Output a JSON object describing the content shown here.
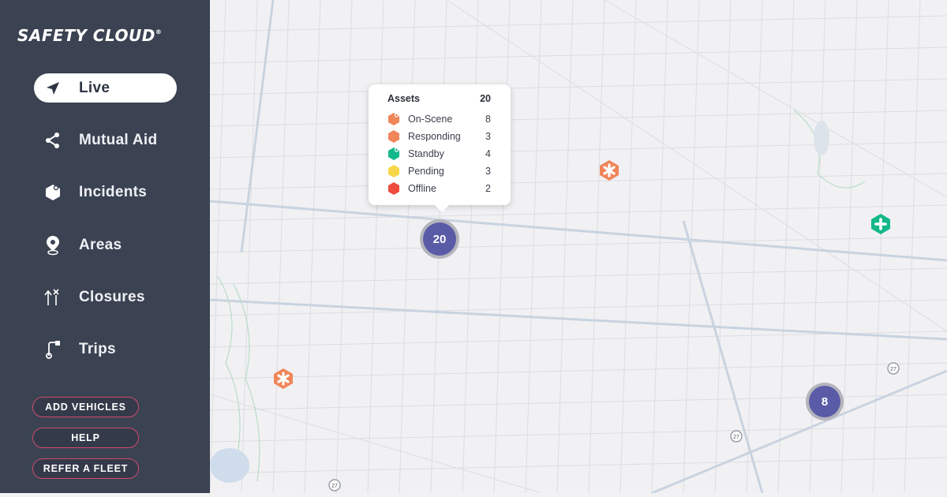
{
  "brand": {
    "name": "SAFETY CLOUD",
    "mark": "®"
  },
  "nav": [
    {
      "label": "Live",
      "icon": "navigation-arrow-icon",
      "active": true
    },
    {
      "label": "Mutual Aid",
      "icon": "share-icon",
      "active": false
    },
    {
      "label": "Incidents",
      "icon": "incident-shield-icon",
      "active": false
    },
    {
      "label": "Areas",
      "icon": "location-pin-icon",
      "active": false
    },
    {
      "label": "Closures",
      "icon": "closure-arrows-icon",
      "active": false
    },
    {
      "label": "Trips",
      "icon": "trip-route-icon",
      "active": false
    }
  ],
  "buttons": {
    "add_vehicles": "ADD VEHICLES",
    "help": "HELP",
    "refer": "REFER A FLEET"
  },
  "popup": {
    "title": "Assets",
    "total": "20",
    "rows": [
      {
        "label": "On-Scene",
        "count": "8",
        "color": "#f0855a"
      },
      {
        "label": "Responding",
        "count": "3",
        "color": "#f0855a"
      },
      {
        "label": "Standby",
        "count": "4",
        "color": "#14b88a"
      },
      {
        "label": "Pending",
        "count": "3",
        "color": "#f7d64a"
      },
      {
        "label": "Offline",
        "count": "2",
        "color": "#ee4d3d"
      }
    ]
  },
  "clusters": {
    "main": "20",
    "secondary": "8"
  },
  "road_labels": {
    "r1": "27",
    "r2": "27",
    "r3": "27"
  },
  "colors": {
    "sidebar": "#3b4252",
    "accent": "#d04a6e",
    "cluster": "#5a5ba6",
    "responding": "#f0855a",
    "standby": "#14b88a"
  }
}
